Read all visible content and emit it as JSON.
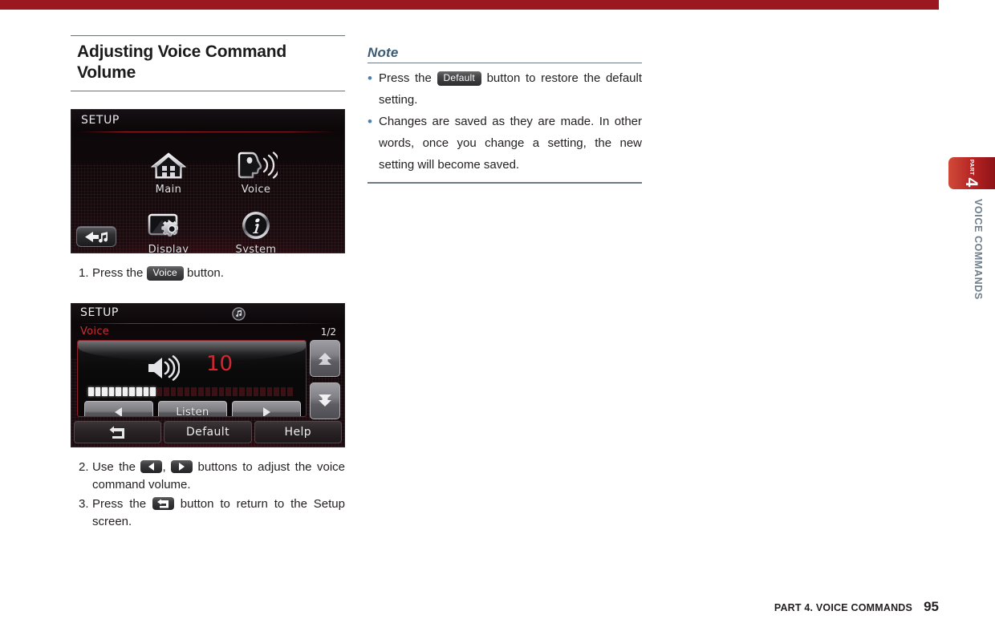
{
  "page": {
    "section_title": "Adjusting Voice Command Volume",
    "footer_text": "PART 4. VOICE COMMANDS",
    "footer_page": "95",
    "side_tab_part": "PART",
    "side_tab_number": "4",
    "side_vertical_label": "VOICE COMMANDS",
    "accent_red": "#9c1820",
    "tab_red": "#b42222",
    "note_blue": "#3b5a74"
  },
  "screen1": {
    "title": "SETUP",
    "icons": [
      {
        "label": "Main",
        "icon": "home-icon"
      },
      {
        "label": "Voice",
        "icon": "voice-head-icon"
      },
      {
        "label": "Display",
        "icon": "display-gear-icon"
      },
      {
        "label": "System",
        "icon": "info-icon"
      }
    ],
    "back_button": "back-music-icon"
  },
  "screen2": {
    "title": "SETUP",
    "music_icon": "music-note-icon",
    "subtitle": "Voice",
    "page_indicator": "1/2",
    "volume_value": "10",
    "speaker_icon": "speaker-icon",
    "segments_total": 30,
    "segments_on": 10,
    "controls": [
      {
        "label": "",
        "icon": "left-triangle-icon",
        "name": "volume-down-button"
      },
      {
        "label": "Listen",
        "icon": "",
        "name": "listen-button"
      },
      {
        "label": "",
        "icon": "right-triangle-icon",
        "name": "volume-up-button"
      }
    ],
    "side_buttons": [
      {
        "icon": "double-chevron-up-icon",
        "name": "scroll-up-button"
      },
      {
        "icon": "double-chevron-down-icon",
        "name": "scroll-down-button"
      }
    ],
    "footer_buttons": [
      {
        "label": "",
        "icon": "return-arrow-icon",
        "name": "return-button"
      },
      {
        "label": "Default",
        "icon": "",
        "name": "default-button"
      },
      {
        "label": "Help",
        "icon": "",
        "name": "help-button"
      }
    ]
  },
  "steps": {
    "step1": {
      "num": "1.",
      "pre": "Press the ",
      "chip": "Voice",
      "post": " button."
    },
    "step2": {
      "num": "2.",
      "pre": "Use the ",
      "mid": ", ",
      "post": " buttons to adjust the voice command volume."
    },
    "step3": {
      "num": "3.",
      "pre": "Press the ",
      "post": " button to return to the Setup screen."
    }
  },
  "note": {
    "title": "Note",
    "item1_pre": "Press the ",
    "item1_chip": "Default",
    "item1_post": " button to restore the default setting.",
    "item2": "Changes are saved as they are made. In other words, once you change a setting, the new setting will become saved."
  }
}
